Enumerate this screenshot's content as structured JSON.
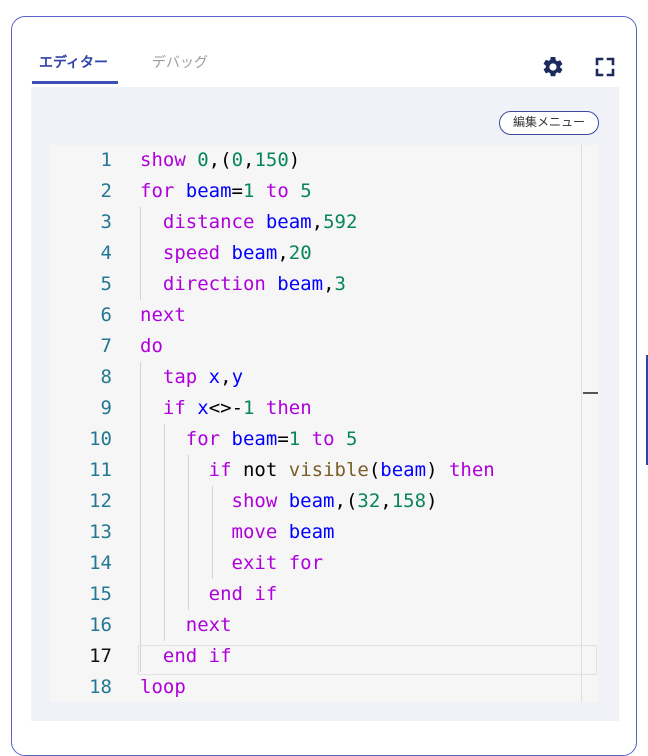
{
  "tabs": [
    {
      "label": "エディター",
      "active": true
    },
    {
      "label": "デバッグ",
      "active": false
    }
  ],
  "toolbar": {
    "settings_icon": "gear-icon",
    "fullscreen_icon": "fullscreen-icon"
  },
  "menu_button": {
    "label": "編集メニュー"
  },
  "editor": {
    "current_line": 17,
    "lines": [
      {
        "n": "1",
        "tokens": [
          {
            "t": "show",
            "c": "kw"
          },
          {
            "t": " ",
            "c": "plain"
          },
          {
            "t": "0",
            "c": "num"
          },
          {
            "t": ",(",
            "c": "plain"
          },
          {
            "t": "0",
            "c": "num"
          },
          {
            "t": ",",
            "c": "plain"
          },
          {
            "t": "150",
            "c": "num"
          },
          {
            "t": ")",
            "c": "plain"
          }
        ]
      },
      {
        "n": "2",
        "tokens": [
          {
            "t": "for",
            "c": "kw"
          },
          {
            "t": " ",
            "c": "plain"
          },
          {
            "t": "beam",
            "c": "var"
          },
          {
            "t": "=",
            "c": "plain"
          },
          {
            "t": "1",
            "c": "num"
          },
          {
            "t": " ",
            "c": "plain"
          },
          {
            "t": "to",
            "c": "kw"
          },
          {
            "t": " ",
            "c": "plain"
          },
          {
            "t": "5",
            "c": "num"
          }
        ]
      },
      {
        "n": "3",
        "tokens": [
          {
            "t": "  ",
            "c": "plain"
          },
          {
            "t": "distance",
            "c": "kw"
          },
          {
            "t": " ",
            "c": "plain"
          },
          {
            "t": "beam",
            "c": "var"
          },
          {
            "t": ",",
            "c": "plain"
          },
          {
            "t": "592",
            "c": "num"
          }
        ]
      },
      {
        "n": "4",
        "tokens": [
          {
            "t": "  ",
            "c": "plain"
          },
          {
            "t": "speed",
            "c": "kw"
          },
          {
            "t": " ",
            "c": "plain"
          },
          {
            "t": "beam",
            "c": "var"
          },
          {
            "t": ",",
            "c": "plain"
          },
          {
            "t": "20",
            "c": "num"
          }
        ]
      },
      {
        "n": "5",
        "tokens": [
          {
            "t": "  ",
            "c": "plain"
          },
          {
            "t": "direction",
            "c": "kw"
          },
          {
            "t": " ",
            "c": "plain"
          },
          {
            "t": "beam",
            "c": "var"
          },
          {
            "t": ",",
            "c": "plain"
          },
          {
            "t": "3",
            "c": "num"
          }
        ]
      },
      {
        "n": "6",
        "tokens": [
          {
            "t": "next",
            "c": "kw"
          }
        ]
      },
      {
        "n": "7",
        "tokens": [
          {
            "t": "do",
            "c": "kw"
          }
        ]
      },
      {
        "n": "8",
        "tokens": [
          {
            "t": "  ",
            "c": "plain"
          },
          {
            "t": "tap",
            "c": "kw"
          },
          {
            "t": " ",
            "c": "plain"
          },
          {
            "t": "x",
            "c": "var"
          },
          {
            "t": ",",
            "c": "plain"
          },
          {
            "t": "y",
            "c": "var"
          }
        ]
      },
      {
        "n": "9",
        "tokens": [
          {
            "t": "  ",
            "c": "plain"
          },
          {
            "t": "if",
            "c": "kw"
          },
          {
            "t": " ",
            "c": "plain"
          },
          {
            "t": "x",
            "c": "var"
          },
          {
            "t": "<>-",
            "c": "plain"
          },
          {
            "t": "1",
            "c": "num"
          },
          {
            "t": " ",
            "c": "plain"
          },
          {
            "t": "then",
            "c": "kw"
          }
        ]
      },
      {
        "n": "10",
        "tokens": [
          {
            "t": "    ",
            "c": "plain"
          },
          {
            "t": "for",
            "c": "kw"
          },
          {
            "t": " ",
            "c": "plain"
          },
          {
            "t": "beam",
            "c": "var"
          },
          {
            "t": "=",
            "c": "plain"
          },
          {
            "t": "1",
            "c": "num"
          },
          {
            "t": " ",
            "c": "plain"
          },
          {
            "t": "to",
            "c": "kw"
          },
          {
            "t": " ",
            "c": "plain"
          },
          {
            "t": "5",
            "c": "num"
          }
        ]
      },
      {
        "n": "11",
        "tokens": [
          {
            "t": "      ",
            "c": "plain"
          },
          {
            "t": "if",
            "c": "kw"
          },
          {
            "t": " ",
            "c": "plain"
          },
          {
            "t": "not",
            "c": "plain"
          },
          {
            "t": " ",
            "c": "plain"
          },
          {
            "t": "visible",
            "c": "fn"
          },
          {
            "t": "(",
            "c": "plain"
          },
          {
            "t": "beam",
            "c": "var"
          },
          {
            "t": ")",
            "c": "plain"
          },
          {
            "t": " ",
            "c": "plain"
          },
          {
            "t": "then",
            "c": "kw"
          }
        ]
      },
      {
        "n": "12",
        "tokens": [
          {
            "t": "        ",
            "c": "plain"
          },
          {
            "t": "show",
            "c": "kw"
          },
          {
            "t": " ",
            "c": "plain"
          },
          {
            "t": "beam",
            "c": "var"
          },
          {
            "t": ",(",
            "c": "plain"
          },
          {
            "t": "32",
            "c": "num"
          },
          {
            "t": ",",
            "c": "plain"
          },
          {
            "t": "158",
            "c": "num"
          },
          {
            "t": ")",
            "c": "plain"
          }
        ]
      },
      {
        "n": "13",
        "tokens": [
          {
            "t": "        ",
            "c": "plain"
          },
          {
            "t": "move",
            "c": "kw"
          },
          {
            "t": " ",
            "c": "plain"
          },
          {
            "t": "beam",
            "c": "var"
          }
        ]
      },
      {
        "n": "14",
        "tokens": [
          {
            "t": "        ",
            "c": "plain"
          },
          {
            "t": "exit",
            "c": "kw"
          },
          {
            "t": " ",
            "c": "plain"
          },
          {
            "t": "for",
            "c": "kw"
          }
        ]
      },
      {
        "n": "15",
        "tokens": [
          {
            "t": "      ",
            "c": "plain"
          },
          {
            "t": "end",
            "c": "kw"
          },
          {
            "t": " ",
            "c": "plain"
          },
          {
            "t": "if",
            "c": "kw"
          }
        ]
      },
      {
        "n": "16",
        "tokens": [
          {
            "t": "    ",
            "c": "plain"
          },
          {
            "t": "next",
            "c": "kw"
          }
        ]
      },
      {
        "n": "17",
        "tokens": [
          {
            "t": "  ",
            "c": "plain"
          },
          {
            "t": "end",
            "c": "kw"
          },
          {
            "t": " ",
            "c": "plain"
          },
          {
            "t": "if",
            "c": "kw"
          }
        ]
      },
      {
        "n": "18",
        "tokens": [
          {
            "t": "loop",
            "c": "kw"
          }
        ]
      }
    ]
  }
}
